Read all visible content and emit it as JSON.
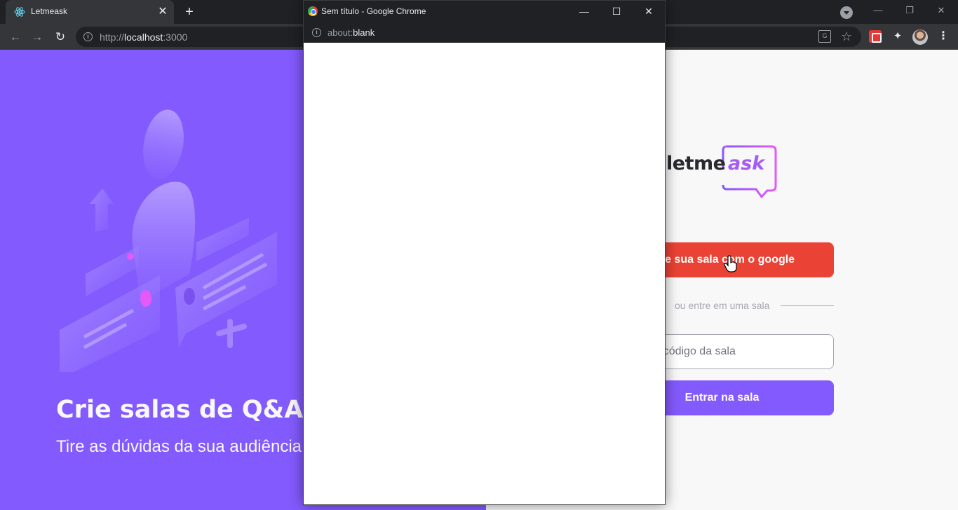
{
  "browser": {
    "tab_title": "Letmeask",
    "tab_close": "✕",
    "new_tab": "+",
    "url_scheme": "http://",
    "url_host": "localhost",
    "url_port": ":3000",
    "window_controls": [
      "—",
      "❐",
      "✕"
    ]
  },
  "app": {
    "aside": {
      "title": "Crie salas de Q&A ao-vivo",
      "subtitle": "Tire as dúvidas da sua audiência em tempo-real"
    },
    "logo": {
      "part1": "letme",
      "part2": "ask"
    },
    "google_button": "Crie sua sala com o google",
    "separator": "ou entre em uma sala",
    "room_input_placeholder": "Digite o código da sala",
    "enter_button": "Entrar na sala",
    "colors": {
      "brand": "#835afd",
      "google": "#ea4335",
      "background": "#f8f8f8",
      "accent": "#e559f9"
    }
  },
  "popup": {
    "title": "Sem título - Google Chrome",
    "url_scheme": "about:",
    "url_page": "blank",
    "controls": [
      "—",
      "☐",
      "✕"
    ]
  }
}
